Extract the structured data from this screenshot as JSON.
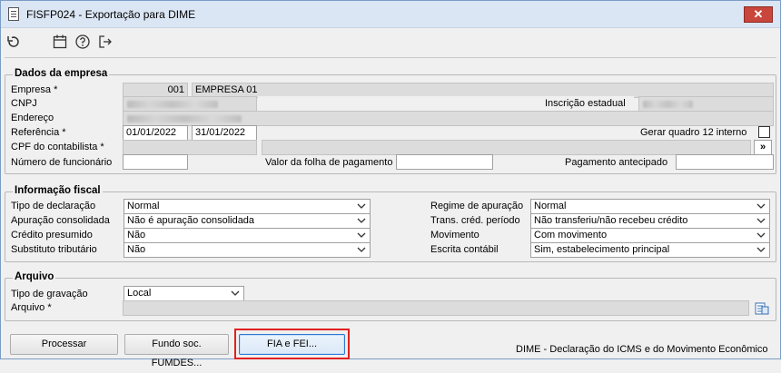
{
  "window": {
    "title": "FISFP024 - Exportação para DIME",
    "close_label": "✕"
  },
  "toolbar": {
    "icons": [
      "undo-icon",
      "calendar-icon",
      "help-icon",
      "exit-icon"
    ]
  },
  "empresa_group": {
    "legend": "Dados da empresa",
    "empresa_label": "Empresa *",
    "empresa_code": "001",
    "empresa_name": "EMPRESA 01",
    "cnpj_label": "CNPJ",
    "inscricao_label": "Inscrição estadual",
    "endereco_label": "Endereço",
    "referencia_label": "Referência *",
    "referencia_start": "01/01/2022",
    "referencia_end": "31/01/2022",
    "gerar_quadro_label": "Gerar quadro 12 interno",
    "cpf_label": "CPF do contabilista *",
    "more_label": "»",
    "num_func_label": "Número de funcionário",
    "valor_folha_label": "Valor da folha de pagamento",
    "pag_antecipado_label": "Pagamento antecipado"
  },
  "fiscal_group": {
    "legend": "Informação fiscal",
    "tipo_decl_label": "Tipo de declaração",
    "tipo_decl_value": "Normal",
    "apur_consol_label": "Apuração consolidada",
    "apur_consol_value": "Não é apuração consolidada",
    "cred_presumido_label": "Crédito presumido",
    "cred_presumido_value": "Não",
    "subst_trib_label": "Substituto tributário",
    "subst_trib_value": "Não",
    "regime_label": "Regime de apuração",
    "regime_value": "Normal",
    "trans_cred_label": "Trans. créd. período",
    "trans_cred_value": "Não transferiu/não recebeu crédito",
    "movimento_label": "Movimento",
    "movimento_value": "Com movimento",
    "escrita_label": "Escrita contábil",
    "escrita_value": "Sim, estabelecimento principal"
  },
  "arquivo_group": {
    "legend": "Arquivo",
    "tipo_grav_label": "Tipo de gravação",
    "tipo_grav_value": "Local",
    "arquivo_label": "Arquivo *"
  },
  "buttons": {
    "processar": "Processar",
    "fundo": "Fundo soc. FUMDES...",
    "fia": "FIA e FEI..."
  },
  "status": "DIME - Declaração do ICMS e do Movimento Econômico"
}
